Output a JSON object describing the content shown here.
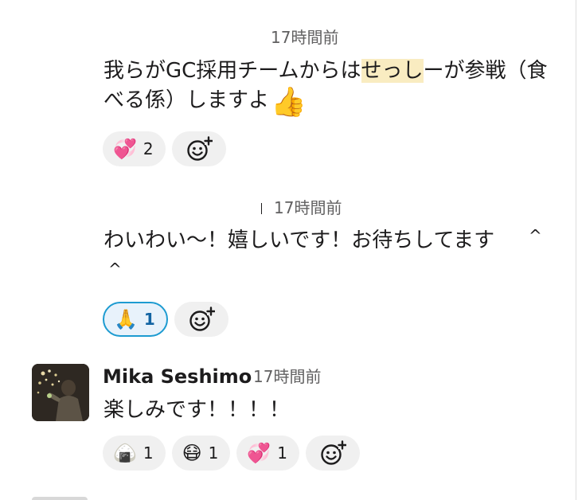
{
  "messages": [
    {
      "time": "17時間前",
      "text_before": "我らがGC採用チームからは",
      "text_highlight": "せっし",
      "text_after": "ーが参戦（食べる係）しますよ",
      "trailing_emoji": "👍",
      "reactions": [
        {
          "emoji": "💞",
          "emoji_name": "revolving-hearts",
          "count": "2",
          "active": false
        }
      ]
    },
    {
      "time": "17時間前",
      "text": "わいわい〜！嬉しいです！お待ちしてます",
      "caret1": "^",
      "caret2": "^",
      "reactions": [
        {
          "emoji": "🙏",
          "emoji_name": "folded-hands",
          "count": "1",
          "active": true
        }
      ]
    },
    {
      "author": "Mika Seshimo",
      "time": "17時間前",
      "text": "楽しみです！！！！",
      "reactions": [
        {
          "emoji": "🍙",
          "emoji_name": "rice-ball",
          "count": "1",
          "active": false
        },
        {
          "emoji": "😷",
          "emoji_name": "bandaged-face",
          "count": "1",
          "active": false
        },
        {
          "emoji": "💞",
          "emoji_name": "revolving-hearts",
          "count": "1",
          "active": false
        }
      ]
    }
  ],
  "add_reaction_icon": "add-reaction-icon",
  "colors": {
    "highlight": "#f9ecc1",
    "active_border": "#1d9bd1",
    "active_bg": "#e8f2fb",
    "active_text": "#1264a3",
    "timestamp": "#616061"
  }
}
